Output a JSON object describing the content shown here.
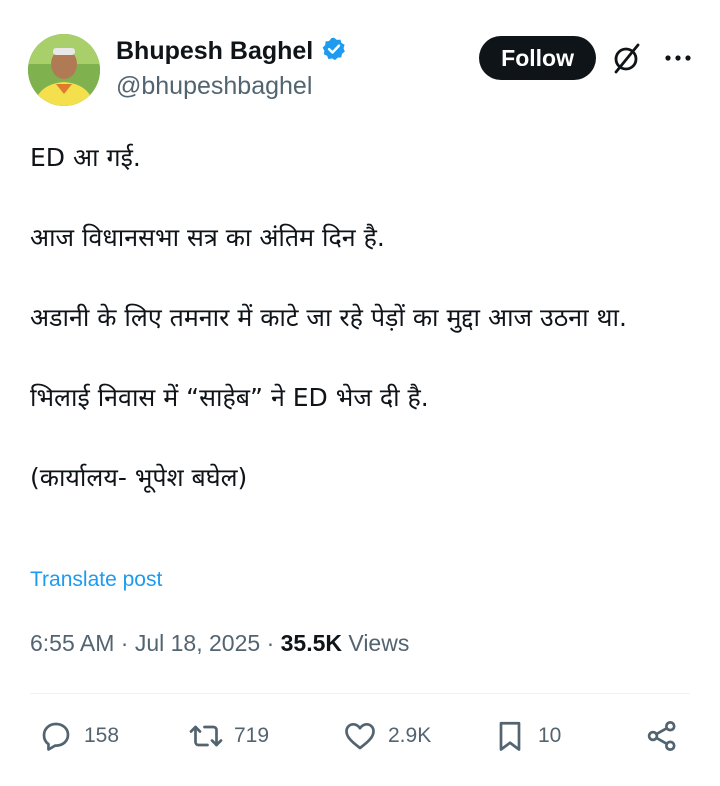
{
  "user": {
    "display_name": "Bhupesh Baghel",
    "handle": "@bhupeshbaghel",
    "verified": true,
    "verified_color": "#1d9bf0"
  },
  "actions_top": {
    "follow_label": "Follow",
    "grok_icon": "grok-icon",
    "more_icon": "more-icon"
  },
  "post": {
    "paragraphs": [
      "ED आ गई.",
      "आज विधानसभा सत्र का अंतिम दिन है.",
      "अडानी के लिए तमनार में काटे जा रहे पेड़ों का मुद्दा आज उठना था.",
      "भिलाई निवास में “साहेब” ने ED भेज दी है.",
      "(कार्यालय- भूपेश बघेल)"
    ],
    "translate_label": "Translate post"
  },
  "meta": {
    "time": "6:55 AM",
    "separator": "·",
    "date": "Jul 18, 2025",
    "views_count": "35.5K",
    "views_label": "Views"
  },
  "engagement": {
    "replies": "158",
    "reposts": "719",
    "likes": "2.9K",
    "bookmarks": "10"
  },
  "colors": {
    "text": "#0f1419",
    "secondary": "#536471",
    "accent": "#1d9bf0"
  }
}
